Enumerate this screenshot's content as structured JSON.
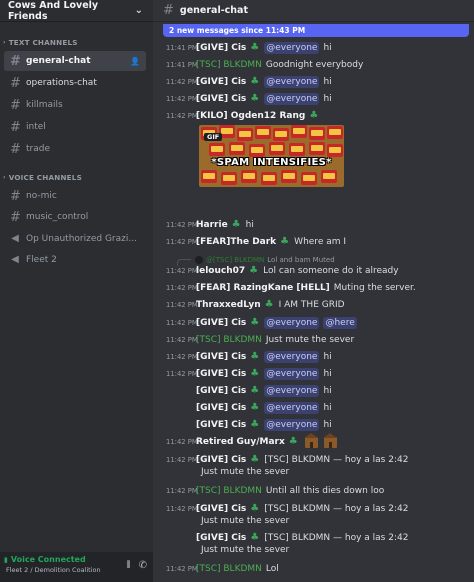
{
  "server": {
    "name": "Cows And Lovely Friends"
  },
  "categories": {
    "text": "TEXT CHANNELS",
    "voice": "VOICE CHANNELS"
  },
  "text_channels": [
    "general-chat",
    "operations-chat",
    "killmails",
    "intel",
    "trade"
  ],
  "voice_channels": [
    "no-mic",
    "music_control",
    "Op Unauthorized Grazi...",
    "Fleet 2"
  ],
  "voice_panel": {
    "status": "Voice Connected",
    "location": "Fleet 2 / Demolition Coalition"
  },
  "channel": {
    "name": "general-chat",
    "new_messages": "2 new messages since 11:43 PM"
  },
  "mentions": {
    "everyone": "@everyone",
    "here": "@here"
  },
  "gif": {
    "tag": "GIF",
    "caption": "*SPAM INTENSIFIES*"
  },
  "messages": [
    {
      "ts": "11:41 PM",
      "name": "[GIVE] Cis",
      "text": "hi"
    },
    {
      "ts": "11:41 PM",
      "name": "[TSC] BLKDMN",
      "text": "Goodnight everybody"
    },
    {
      "ts": "11:42 PM",
      "name": "[GIVE] Cis",
      "text": "hi"
    },
    {
      "ts": "11:42 PM",
      "name": "[GIVE] Cis",
      "text": "hi"
    },
    {
      "ts": "11:42 PM",
      "name": "[KILO] Ogden12 Rang"
    },
    {
      "ts": "11:42 PM",
      "name": "Harrie",
      "text": "hi"
    },
    {
      "ts": "11:42 PM",
      "name": "[FEAR]The Dark",
      "text": "Where am I"
    },
    {
      "reply_name": "@[TSC] BLKDMN",
      "reply_text": "Lol and bam Muted"
    },
    {
      "ts": "11:42 PM",
      "name": "lelouch07",
      "text": "Lol can someone do it already"
    },
    {
      "ts": "11:42 PM",
      "name": "[FEAR] RazingKane [HELL]",
      "text": "Muting the server."
    },
    {
      "ts": "11:42 PM",
      "name": "ThraxxedLyn",
      "text": "I AM THE GRID"
    },
    {
      "ts": "11:42 PM",
      "name": "[GIVE] Cis"
    },
    {
      "ts": "11:42 PM",
      "name": "[TSC] BLKDMN",
      "text": "Just mute the sever"
    },
    {
      "ts": "11:42 PM",
      "name": "[GIVE] Cis",
      "text": "hi"
    },
    {
      "ts": "11:42 PM",
      "name": "[GIVE] Cis",
      "text": "hi"
    },
    {
      "name": "[GIVE] Cis",
      "text": "hi"
    },
    {
      "name": "[GIVE] Cis",
      "text": "hi"
    },
    {
      "name": "[GIVE] Cis",
      "text": "hi"
    },
    {
      "ts": "11:42 PM",
      "name": "Retired Guy/Marx"
    },
    {
      "ts": "11:42 PM",
      "name": "[GIVE] Cis",
      "text": "[TSC] BLKDMN — hoy a las 2:42",
      "cont": "Just mute the sever"
    },
    {
      "ts": "11:42 PM",
      "name": "[TSC] BLKDMN",
      "text": "Until all this dies down loo"
    },
    {
      "ts": "11:42 PM",
      "name": "[GIVE] Cis",
      "text": "[TSC] BLKDMN — hoy a las 2:42",
      "cont": "Just mute the sever"
    },
    {
      "name": "[GIVE] Cis",
      "text": "[TSC] BLKDMN — hoy a las 2:42",
      "cont": "Just mute the sever"
    },
    {
      "ts": "11:42 PM",
      "name": "[TSC] BLKDMN",
      "text": "Lol"
    }
  ]
}
